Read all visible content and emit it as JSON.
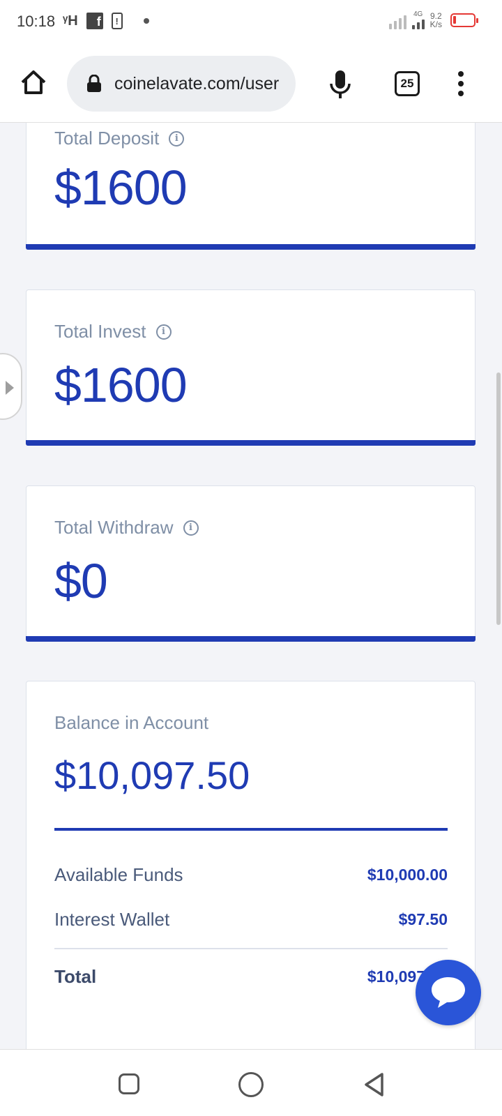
{
  "status_bar": {
    "time": "10:18",
    "network_glyph": "ᵞH",
    "facebook_icon": "f",
    "alert_icon": "!",
    "network_type": "4G",
    "speed_value": "9.2",
    "speed_unit": "K/s"
  },
  "browser": {
    "url": "coinelavate.com/user",
    "tab_count": "25"
  },
  "cards": {
    "deposit": {
      "label": "Total Deposit",
      "value": "$1600"
    },
    "invest": {
      "label": "Total Invest",
      "value": "$1600"
    },
    "withdraw": {
      "label": "Total Withdraw",
      "value": "$0"
    }
  },
  "balance": {
    "label": "Balance in Account",
    "value": "$10,097.50",
    "rows": [
      {
        "label": "Available Funds",
        "value": "$10,000.00"
      },
      {
        "label": "Interest Wallet",
        "value": "$97.50"
      },
      {
        "label": "Total",
        "value": "$10,097.50"
      }
    ]
  },
  "colors": {
    "accent": "#1f3bb3",
    "label": "#7f8fa6",
    "chat": "#2a55d8",
    "battery": "#e53935"
  },
  "icons": [
    "home-icon",
    "lock-icon",
    "mic-icon",
    "tabs-icon",
    "menu-icon",
    "info-icon",
    "chat-icon",
    "recents-icon",
    "home-circle-icon",
    "back-icon"
  ]
}
